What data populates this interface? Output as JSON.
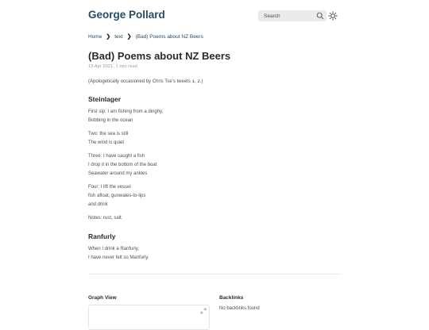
{
  "site": {
    "title": "George Pollard"
  },
  "search": {
    "label": "Search",
    "icon": "search-icon"
  },
  "theme": {
    "icon": "sun-icon"
  },
  "breadcrumb": {
    "items": [
      "Home",
      "text",
      "(Bad) Poems about NZ Beers"
    ]
  },
  "article": {
    "title": "(Bad) Poems about NZ Beers",
    "date": "13 Apr 2021",
    "read_time": "1 min read",
    "intro": {
      "prefix": "(Apologetically occasioned by Chris Tse’s tweets ",
      "link1": "1",
      "link2": "2",
      "suffix": ".)"
    },
    "sections": [
      {
        "heading": "Steinlager",
        "paragraphs": [
          [
            "First sip: I am fishing from a dinghy,",
            "Bobbing in the ocean"
          ],
          [
            "Two: the sea is still",
            "The wind is quiet"
          ],
          [
            "Three: I have caught a fish",
            "I drop it in the bottom of the boat",
            "Seawater around my ankles"
          ],
          [
            "Four: I lift the vessel",
            "fish afloat, gunwales-to-lips",
            "and drink"
          ],
          [
            "Notes: rust, salt."
          ]
        ]
      },
      {
        "heading": "Ranfurly",
        "paragraphs": [
          [
            "When I drink a Ranfurly,",
            "I have never felt so Manfurly."
          ]
        ]
      }
    ]
  },
  "footer": {
    "graph_heading": "Graph View",
    "backlinks_heading": "Backlinks",
    "backlinks_empty": "No backlinks found"
  },
  "colors": {
    "accent": "#284b63",
    "text": "#4e4e4e",
    "heading": "#2b2b2b",
    "muted": "#9a9a9a",
    "search_bg": "#ebebec"
  }
}
